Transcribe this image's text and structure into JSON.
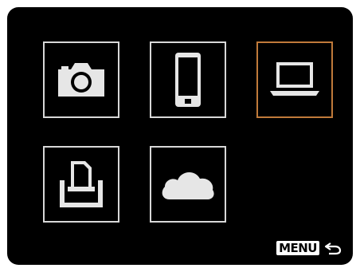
{
  "screen": {
    "tiles": [
      {
        "id": "camera",
        "icon": "camera-icon",
        "selected": false
      },
      {
        "id": "smartphone",
        "icon": "smartphone-icon",
        "selected": false
      },
      {
        "id": "computer",
        "icon": "laptop-icon",
        "selected": true
      },
      {
        "id": "printer",
        "icon": "printer-icon",
        "selected": false
      },
      {
        "id": "web-service",
        "icon": "cloud-icon",
        "selected": false
      }
    ],
    "colors": {
      "background": "#000000",
      "tile_border": "#d8d8d8",
      "selected_border": "#c07a3a",
      "icon": "#e6e6e6"
    }
  },
  "footer": {
    "menu_label": "MENU",
    "back_icon": "return-arrow-icon"
  }
}
